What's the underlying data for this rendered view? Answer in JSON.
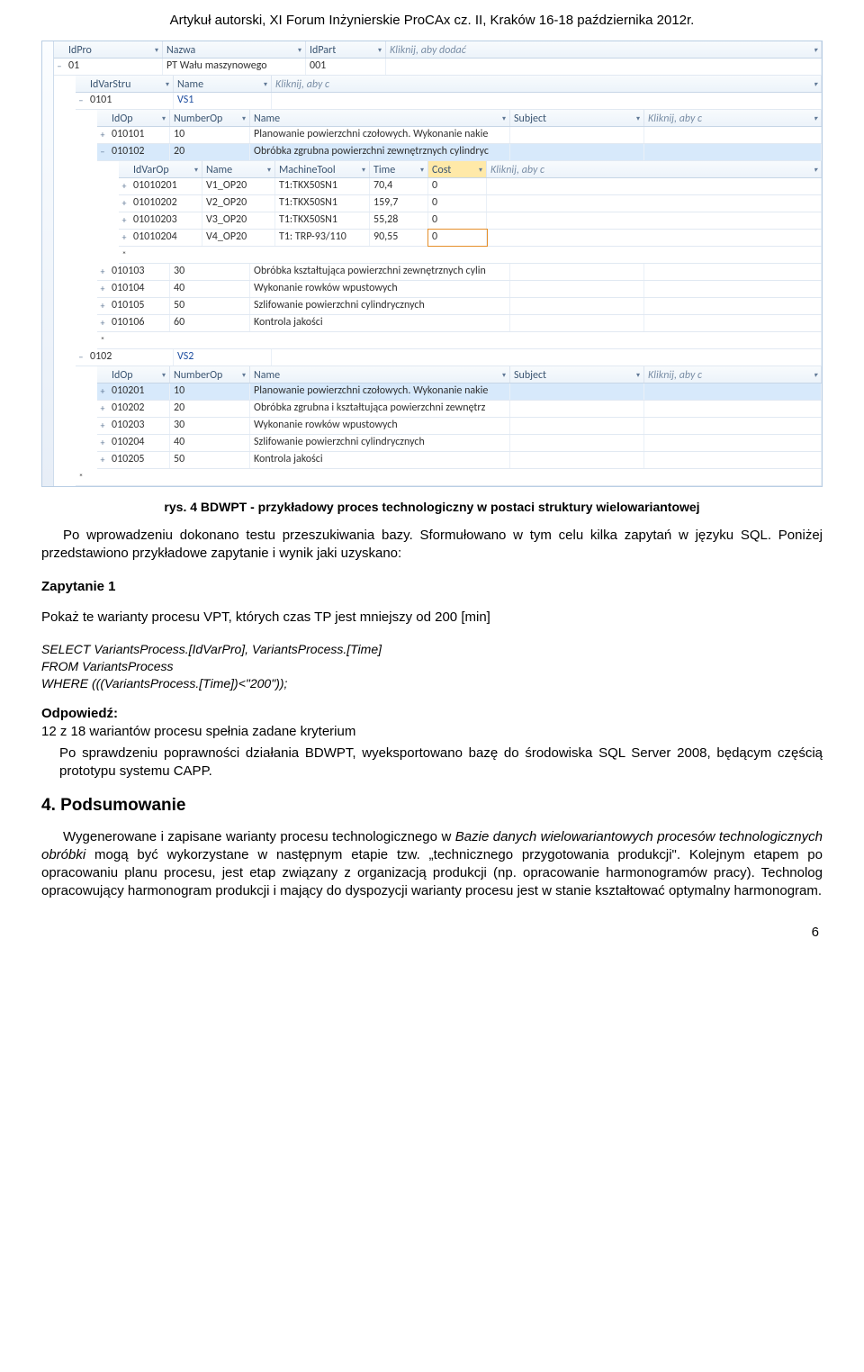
{
  "top_header": "Artykuł autorski, XI Forum Inżynierskie ProCAx cz. II, Kraków 16-18 października 2012r.",
  "grid": {
    "l0_headers": [
      "IdPro",
      "Nazwa",
      "IdPart",
      "Kliknij, aby dodać"
    ],
    "l0_row": {
      "idpro": "01",
      "nazwa": "PT Wału maszynowego",
      "idpart": "001"
    },
    "l1_headers": [
      "IdVarStru",
      "Name",
      "Kliknij, aby c"
    ],
    "l1_row_a": {
      "id": "0101",
      "name": "VS1"
    },
    "l2_headers": [
      "IdOp",
      "NumberOp",
      "Name",
      "Subject",
      "Kliknij, aby c"
    ],
    "l2_rows_a": [
      {
        "idop": "010101",
        "num": "10",
        "name": "Planowanie powierzchni czołowych. Wykonanie nakie",
        "hl": false,
        "exp": "+"
      },
      {
        "idop": "010102",
        "num": "20",
        "name": "Obróbka zgrubna powierzchni zewnętrznych cylindryc",
        "hl": true,
        "exp": "−"
      }
    ],
    "l3_headers": [
      "IdVarOp",
      "Name",
      "MachineTool",
      "Time",
      "Cost",
      "Kliknij, aby c"
    ],
    "l3_rows": [
      {
        "id": "01010201",
        "name": "V1_OP20",
        "tool": "T1:TKX50SN1",
        "time": "70,4",
        "cost": "0",
        "pencil": false
      },
      {
        "id": "01010202",
        "name": "V2_OP20",
        "tool": "T1:TKX50SN1",
        "time": "159,7",
        "cost": "0",
        "pencil": false
      },
      {
        "id": "01010203",
        "name": "V3_OP20",
        "tool": "T1:TKX50SN1",
        "time": "55,28",
        "cost": "0",
        "pencil": false
      },
      {
        "id": "01010204",
        "name": "V4_OP20",
        "tool": "T1: TRP-93/110",
        "time": "90,55",
        "cost": "0",
        "pencil": true
      }
    ],
    "l2_rows_b": [
      {
        "idop": "010103",
        "num": "30",
        "name": "Obróbka kształtująca powierzchni zewnętrznych cylin",
        "exp": "+"
      },
      {
        "idop": "010104",
        "num": "40",
        "name": "Wykonanie rowków wpustowych",
        "exp": "+"
      },
      {
        "idop": "010105",
        "num": "50",
        "name": "Szlifowanie powierzchni cylindrycznych",
        "exp": "+"
      },
      {
        "idop": "010106",
        "num": "60",
        "name": "Kontrola jakości",
        "exp": "+"
      }
    ],
    "l1_row_b": {
      "id": "0102",
      "name": "VS2"
    },
    "l2_rows_c": [
      {
        "idop": "010201",
        "num": "10",
        "name": "Planowanie powierzchni czołowych. Wykonanie nakie",
        "hl": true,
        "exp": "+"
      },
      {
        "idop": "010202",
        "num": "20",
        "name": "Obróbka zgrubna i kształtująca  powierzchni zewnętrz",
        "hl": false,
        "exp": "+"
      },
      {
        "idop": "010203",
        "num": "30",
        "name": "Wykonanie rowków wpustowych",
        "hl": false,
        "exp": "+"
      },
      {
        "idop": "010204",
        "num": "40",
        "name": "Szlifowanie powierzchni cylindrycznych",
        "hl": false,
        "exp": "+"
      },
      {
        "idop": "010205",
        "num": "50",
        "name": "Kontrola jakości",
        "hl": false,
        "exp": "+"
      }
    ]
  },
  "caption": "rys. 4 BDWPT - przykładowy proces technologiczny w postaci struktury wielowariantowej",
  "para1": "Po wprowadzeniu dokonano testu przeszukiwania bazy. Sformułowano w tym celu kilka zapytań w języku SQL. Poniżej przedstawiono przykładowe zapytanie i wynik  jaki uzyskano:",
  "query_title": "Zapytanie 1",
  "query_text": "Pokaż te warianty procesu VPT, których czas TP jest mniejszy od 200 [min]",
  "sql1": "SELECT VariantsProcess.[IdVarPro], VariantsProcess.[Time]",
  "sql2": "FROM VariantsProcess",
  "sql3": "WHERE (((VariantsProcess.[Time])<\"200\"));",
  "answer_title": "Odpowiedź:",
  "answer_text": "12 z 18 wariantów procesu spełnia zadane kryterium",
  "para2": "Po sprawdzeniu poprawności działania BDWPT, wyeksportowano bazę do środowiska SQL Server 2008, będącym częścią prototypu systemu CAPP.",
  "section_title": "4. Podsumowanie",
  "para3": "Wygenerowane i zapisane warianty procesu technologicznego w Bazie danych wielowariantowych procesów technologicznych obróbki mogą być wykorzystane w następnym etapie tzw. „technicznego przygotowania produkcji\". Kolejnym etapem po opracowaniu planu procesu, jest etap związany z organizacją produkcji (np. opracowanie harmonogramów pracy). Technolog opracowujący harmonogram produkcji i mający do dyspozycji warianty procesu jest w stanie kształtować optymalny harmonogram.",
  "page_number": "6"
}
